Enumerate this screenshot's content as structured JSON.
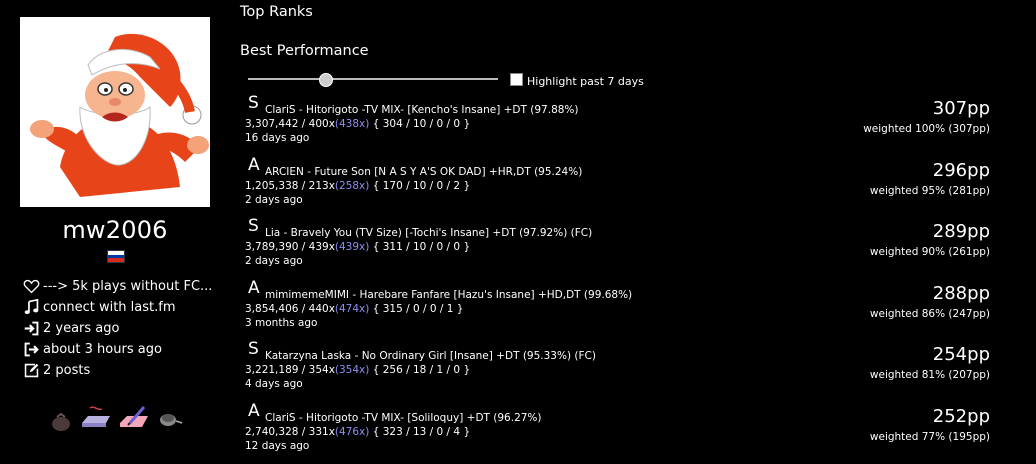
{
  "profile": {
    "username": "mw2006",
    "country_flag": "russia-flag",
    "description": "---> 5k plays without FC...",
    "lastfm": "connect with last.fm",
    "joined": "2 years ago",
    "last_seen": "about 3 hours ago",
    "posts": "2 posts",
    "badges": [
      "pouch-badge",
      "keyboard-badge",
      "drawing-tablet-badge",
      "mouse-badge"
    ]
  },
  "sections": {
    "top_ranks": "Top Ranks",
    "best_performance": "Best Performance"
  },
  "controls": {
    "slider_level": 0.31,
    "highlight_label": "Highlight past 7 days",
    "highlight_checked": false
  },
  "scores": [
    {
      "rank": "S",
      "title": "ClariS - Hitorigoto -TV MIX- [Kencho's Insane] +DT (97.88%)",
      "stats_pre": "3,307,442 / 400x",
      "max_combo": "(438x)",
      "stats_post": " { 304 / 10 / 0 / 0 }",
      "ago": "16 days ago",
      "pp": "307pp",
      "weighted": "weighted 100% (307pp)"
    },
    {
      "rank": "A",
      "title": "ARCIEN - Future Son [N A S Y A'S OK DAD] +HR,DT (95.24%)",
      "stats_pre": "1,205,338 / 213x",
      "max_combo": "(258x)",
      "stats_post": " { 170 / 10 / 0 / 2 }",
      "ago": "2 days ago",
      "pp": "296pp",
      "weighted": "weighted 95% (281pp)"
    },
    {
      "rank": "S",
      "title": "Lia - Bravely You (TV Size) [-Tochi's Insane] +DT (97.92%) (FC)",
      "stats_pre": "3,789,390 / 439x",
      "max_combo": "(439x)",
      "stats_post": " { 311 / 10 / 0 / 0 }",
      "ago": "2 days ago",
      "pp": "289pp",
      "weighted": "weighted 90% (261pp)"
    },
    {
      "rank": "A",
      "title": "mimimemeMIMI - Harebare Fanfare [Hazu's Insane] +HD,DT (99.68%)",
      "stats_pre": "3,854,406 / 440x",
      "max_combo": "(474x)",
      "stats_post": " { 315 / 0 / 0 / 1 }",
      "ago": "3 months ago",
      "pp": "288pp",
      "weighted": "weighted 86% (247pp)"
    },
    {
      "rank": "S",
      "title": "Katarzyna Laska - No Ordinary Girl [Insane] +DT (95.33%) (FC)",
      "stats_pre": "3,221,189 / 354x",
      "max_combo": "(354x)",
      "stats_post": " { 256 / 18 / 1 / 0 }",
      "ago": "4 days ago",
      "pp": "254pp",
      "weighted": "weighted 81% (207pp)"
    },
    {
      "rank": "A",
      "title": "ClariS - Hitorigoto -TV MIX- [Soliloquy] +DT (96.27%)",
      "stats_pre": "2,740,328 / 331x",
      "max_combo": "(476x)",
      "stats_post": " { 323 / 13 / 0 / 4 }",
      "ago": "12 days ago",
      "pp": "252pp",
      "weighted": "weighted 77% (195pp)"
    }
  ]
}
